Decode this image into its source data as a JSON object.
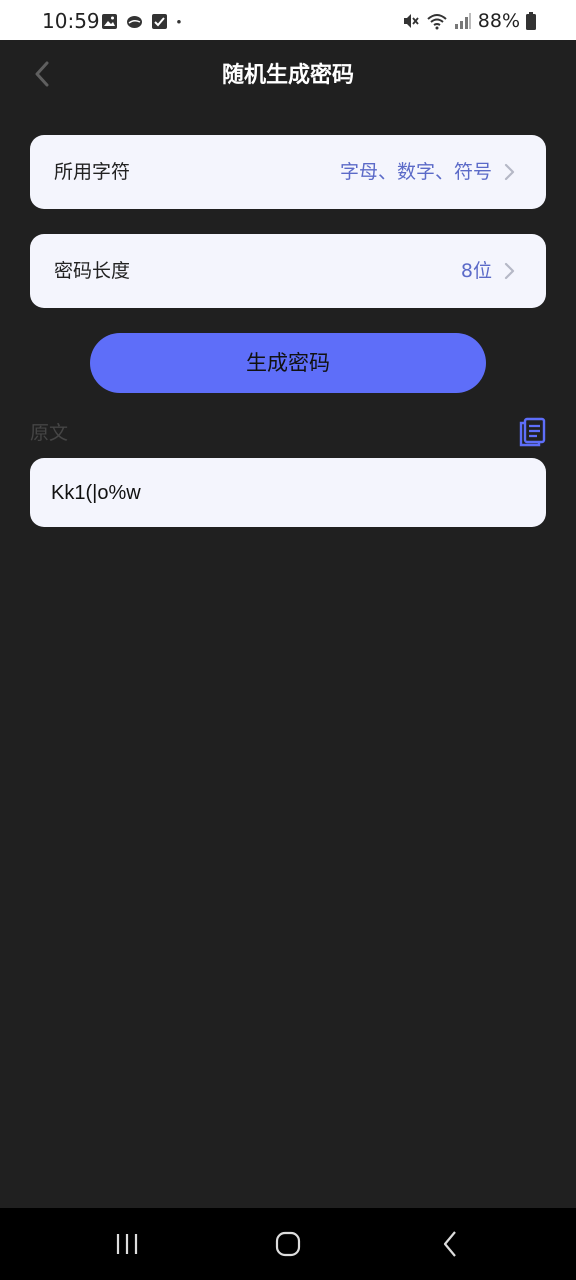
{
  "status_bar": {
    "time": "10:59",
    "left_icons": [
      "image-icon",
      "cloud-icon",
      "check-box-icon",
      "dot-icon"
    ],
    "battery": "88%",
    "right_icons": [
      "mute-icon",
      "wifi-icon",
      "signal-icon",
      "battery-icon"
    ]
  },
  "header": {
    "title": "随机生成密码",
    "back_icon": "chevron-left-icon"
  },
  "settings": {
    "characters": {
      "label": "所用字符",
      "value": "字母、数字、符号"
    },
    "length": {
      "label": "密码长度",
      "value": "8位"
    }
  },
  "generate_button": {
    "label": "生成密码"
  },
  "result": {
    "label": "原文",
    "value": "Kk1(|o%w",
    "copy_icon": "copy-icon"
  },
  "nav_bar": {
    "icons": [
      "recent-apps-icon",
      "home-icon",
      "back-icon"
    ]
  },
  "colors": {
    "background": "#202020",
    "card": "#f4f5fd",
    "accent": "#5e6ef9",
    "value_text": "#5b6ac8"
  }
}
